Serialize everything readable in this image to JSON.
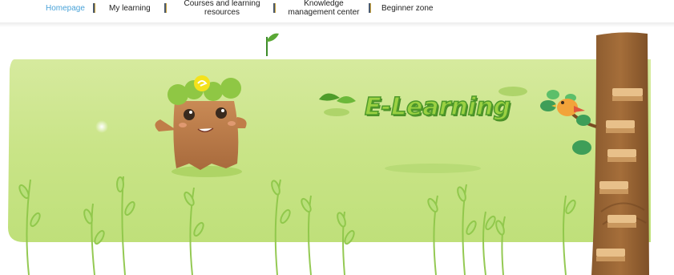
{
  "nav": {
    "items": [
      {
        "label": "Homepage",
        "active": true
      },
      {
        "label": "My learning",
        "active": false
      },
      {
        "label_line1": "Courses and learning",
        "label_line2": "resources",
        "active": false
      },
      {
        "label_line1": "Knowledge",
        "label_line2": "management center",
        "active": false
      },
      {
        "label": "Beginner zone",
        "active": false
      }
    ],
    "active_color": "#4aa3d8",
    "text_color": "#222222"
  },
  "banner": {
    "logo_text": "E-Learning",
    "background_color": "#c9e487",
    "icons": [
      "sprout-icon",
      "tree-stump-mascot",
      "bird-icon",
      "tree-trunk-ladder",
      "plant-leaves"
    ]
  }
}
